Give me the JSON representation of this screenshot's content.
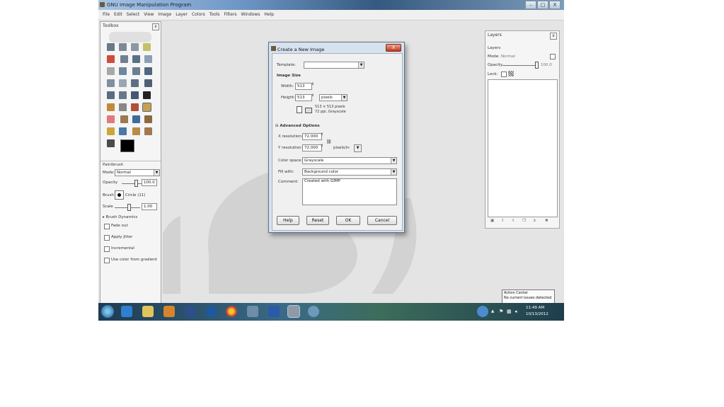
{
  "window": {
    "title": "GNU Image Manipulation Program",
    "minimize": "–",
    "maximize": "□",
    "close": "X"
  },
  "menu": [
    "File",
    "Edit",
    "Select",
    "View",
    "Image",
    "Layer",
    "Colors",
    "Tools",
    "Filters",
    "Windows",
    "Help"
  ],
  "toolbox": {
    "title": "Toolbox",
    "close": "x"
  },
  "tool_options": {
    "title": "Paintbrush",
    "mode_label": "Mode:",
    "mode_value": "Normal",
    "opacity_label": "Opacity",
    "opacity_value": "100.0",
    "brush_label": "Brush",
    "brush_value": "Circle (11)",
    "scale_label": "Scale",
    "scale_value": "1.00",
    "brush_dynamics": "Brush Dynamics",
    "checks": [
      "Fade out",
      "Apply Jitter",
      "Incremental",
      "Use color from gradient"
    ]
  },
  "layers": {
    "title": "Layers",
    "tab": "Layers",
    "mode_label": "Mode:",
    "mode_value": "Normal",
    "opacity_label": "Opacity",
    "opacity_value": "100.0",
    "lock_label": "Lock:"
  },
  "dialog": {
    "title": "Create a New Image",
    "close": "X",
    "template_label": "Template:",
    "template_value": "",
    "image_size": "Image Size",
    "width_label": "Width:",
    "width_value": "513",
    "height_label": "Height:",
    "height_value": "513",
    "unit": "pixels",
    "info_line1": "513 × 513 pixels",
    "info_line2": "72 ppi, Grayscale",
    "advanced": "Advanced Options",
    "xres_label": "X resolution:",
    "xres_value": "72.000",
    "yres_label": "Y resolution:",
    "yres_value": "72.000",
    "res_unit": "pixels/in",
    "colorspace_label": "Color space:",
    "colorspace_value": "Grayscale",
    "fill_label": "Fill with:",
    "fill_value": "Background color",
    "comment_label": "Comment:",
    "comment_value": "Created with GIMP",
    "help": "Help",
    "reset": "Reset",
    "ok": "OK",
    "cancel": "Cancel"
  },
  "action_center": {
    "title": "Action Center",
    "message": "No current issues detected"
  },
  "clock": {
    "time": "11:49 AM",
    "date": "10/13/2012"
  },
  "colors": {
    "taskbar": "#2b5470",
    "dialog_frame": "#d6e2ee",
    "close_red": "#c3381e"
  }
}
